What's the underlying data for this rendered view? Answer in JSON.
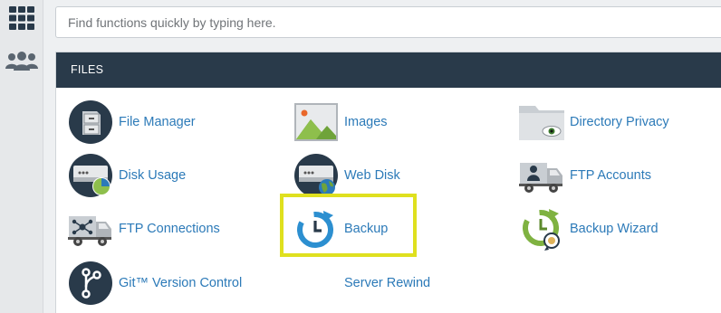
{
  "search": {
    "placeholder": "Find functions quickly by typing here."
  },
  "sidebar": {
    "items": [
      {
        "icon": "grid-icon"
      },
      {
        "icon": "users-icon"
      }
    ]
  },
  "files_section": {
    "title": "FILES",
    "items": [
      {
        "label": "File Manager",
        "icon": "file-manager-icon"
      },
      {
        "label": "Images",
        "icon": "images-icon"
      },
      {
        "label": "Directory Privacy",
        "icon": "directory-privacy-icon"
      },
      {
        "label": "Disk Usage",
        "icon": "disk-usage-icon"
      },
      {
        "label": "Web Disk",
        "icon": "web-disk-icon"
      },
      {
        "label": "FTP Accounts",
        "icon": "ftp-accounts-icon"
      },
      {
        "label": "FTP Connections",
        "icon": "ftp-connections-icon"
      },
      {
        "label": "Backup",
        "icon": "backup-icon"
      },
      {
        "label": "Backup Wizard",
        "icon": "backup-wizard-icon"
      },
      {
        "label": "Git™ Version Control",
        "icon": "git-icon"
      },
      {
        "label": "Server Rewind",
        "icon": ""
      }
    ],
    "highlighted_item": "Backup"
  },
  "colors": {
    "header_bg": "#293a4a",
    "link": "#2c7ab8",
    "highlight": "#dfe01f"
  }
}
